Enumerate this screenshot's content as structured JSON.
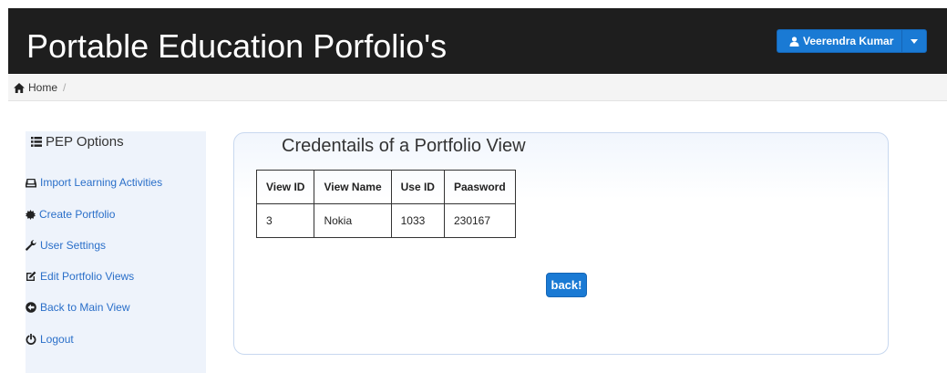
{
  "header": {
    "brand": "Portable Education Porfolio's",
    "user_name": "Veerendra Kumar"
  },
  "breadcrumb": {
    "home": "Home",
    "separator": "/"
  },
  "sidebar": {
    "title": "PEP Options",
    "items": [
      {
        "label": "Import Learning Activities",
        "icon": "hdd-icon"
      },
      {
        "label": "Create Portfolio",
        "icon": "certificate-icon"
      },
      {
        "label": "User Settings",
        "icon": "wrench-icon"
      },
      {
        "label": "Edit Portfolio Views",
        "icon": "edit-icon"
      },
      {
        "label": "Back to Main View",
        "icon": "circle-arrow-left-icon"
      },
      {
        "label": "Logout",
        "icon": "power-icon"
      }
    ]
  },
  "main": {
    "title": "Credentails of a Portfolio View",
    "table": {
      "headers": [
        "View ID",
        "View Name",
        "Use ID",
        "Paasword"
      ],
      "rows": [
        [
          "3",
          "Nokia",
          "1033",
          "230167"
        ]
      ]
    },
    "back_label": "back!"
  },
  "colors": {
    "header_bg": "#1e1e1e",
    "primary": "#1a7ad4",
    "sidebar_bg": "#eef3fb",
    "link": "#2a6fc9"
  }
}
